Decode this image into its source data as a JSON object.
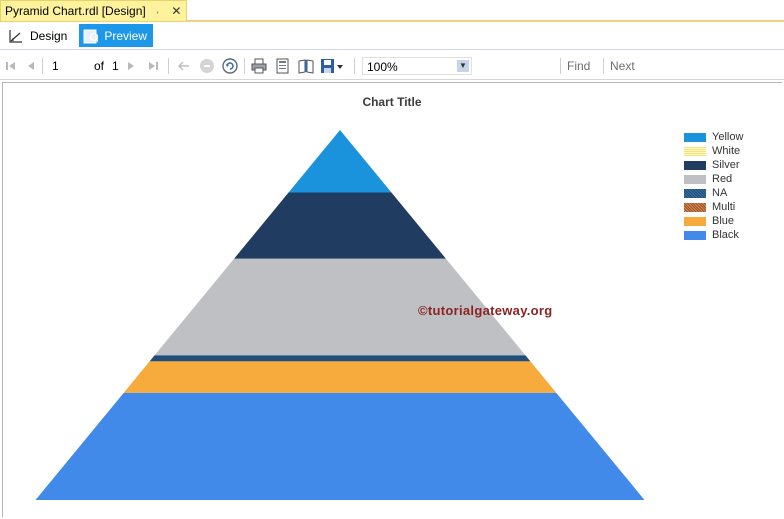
{
  "document_tab": {
    "title": "Pyramid Chart.rdl [Design]"
  },
  "mode_tabs": [
    {
      "label": "Design",
      "active": false
    },
    {
      "label": "Preview",
      "active": true
    }
  ],
  "toolbar": {
    "page_current": "1",
    "of_label": "of",
    "page_total": "1",
    "zoom": "100%",
    "find_label": "Find",
    "next_label": "Next"
  },
  "watermark": "©tutorialgateway.org",
  "chart_data": {
    "type": "pyramid",
    "title": "Chart Title",
    "legend_position": "top-right",
    "segments": [
      {
        "name": "Yellow",
        "color": "#1a93dc",
        "share": 0.165
      },
      {
        "name": "White",
        "color": "#f5e179",
        "share": 0.0
      },
      {
        "name": "Silver",
        "color": "#203c60",
        "share": 0.175
      },
      {
        "name": "Red",
        "color": "#bfc0c4",
        "share": 0.255
      },
      {
        "name": "NA",
        "color": "#1f4e79",
        "share": 0.016
      },
      {
        "name": "Multi",
        "color": "#a0552a",
        "share": 0.0
      },
      {
        "name": "Blue",
        "color": "#f8ab3d",
        "share": 0.083
      },
      {
        "name": "Black",
        "color": "#418ae9",
        "share": 0.283
      }
    ]
  }
}
